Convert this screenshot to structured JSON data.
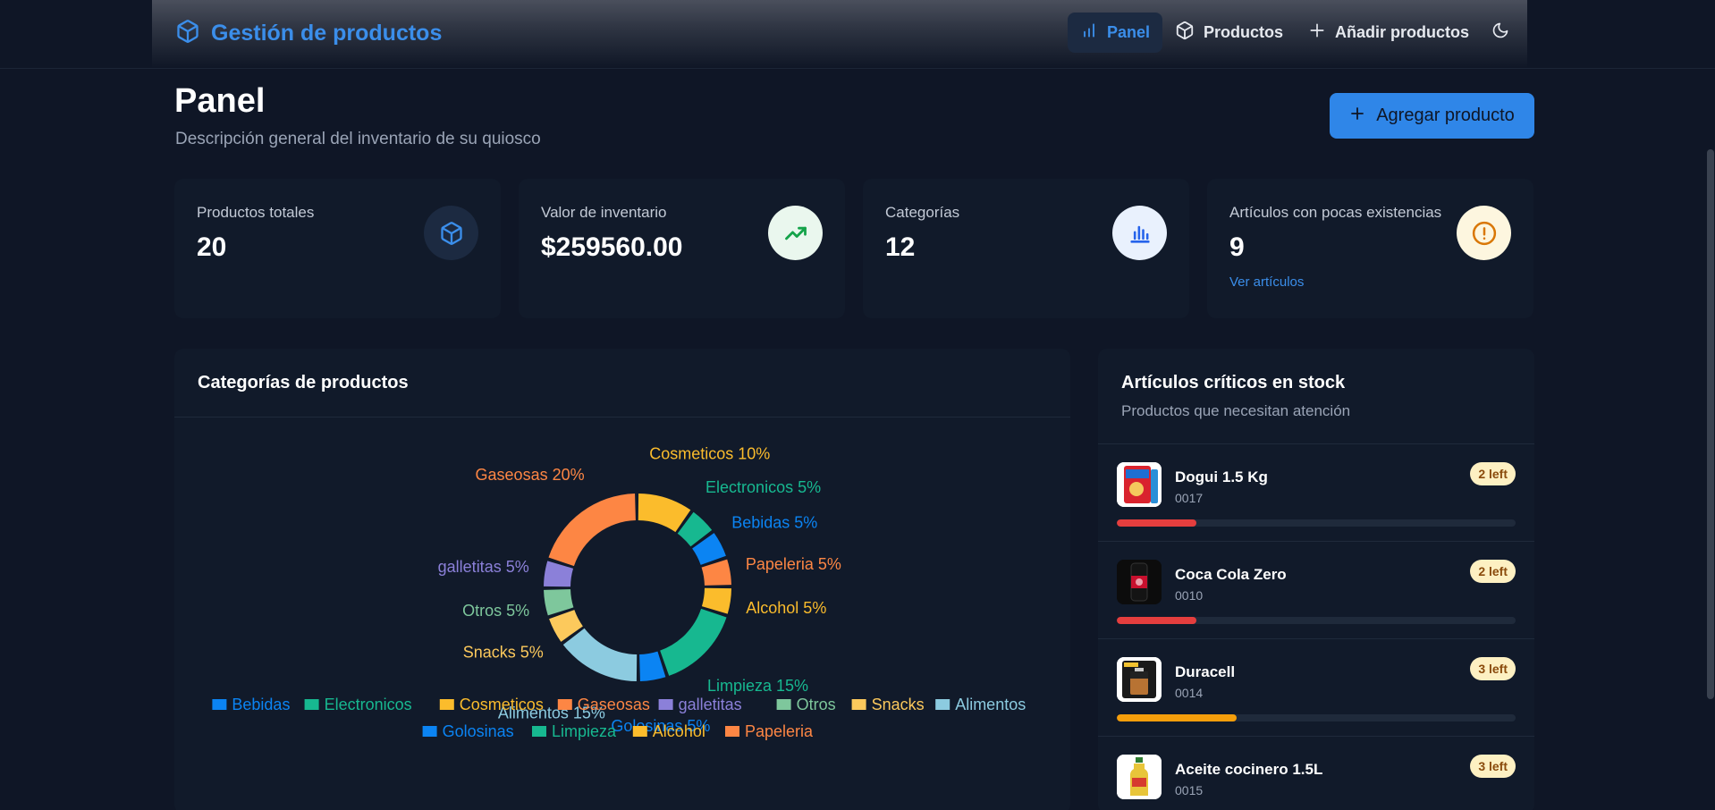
{
  "header": {
    "brand": "Gestión de productos",
    "nav": [
      {
        "label": "Panel",
        "icon": "bar-chart-icon",
        "active": true
      },
      {
        "label": "Productos",
        "icon": "box-icon",
        "active": false
      },
      {
        "label": "Añadir productos",
        "icon": "plus-icon",
        "active": false
      }
    ],
    "theme_icon": "moon-icon"
  },
  "page": {
    "title": "Panel",
    "subtitle": "Descripción general del inventario de su quiosco",
    "add_button": "Agregar producto"
  },
  "stats": [
    {
      "label": "Productos totales",
      "value": "20",
      "icon": "box-icon",
      "icon_bg": "#1c2a41",
      "icon_color": "#3b8eea"
    },
    {
      "label": "Valor de inventario",
      "value": "$259560.00",
      "icon": "trending-up-icon",
      "icon_bg": "#eaf7ee",
      "icon_color": "#15a34a"
    },
    {
      "label": "Categorías",
      "value": "12",
      "icon": "bar-chart-icon",
      "icon_bg": "#e9f1fd",
      "icon_color": "#2563eb"
    },
    {
      "label": "Artículos con pocas existencias",
      "value": "9",
      "link": "Ver artículos",
      "icon": "alert-circle-icon",
      "icon_bg": "#fdf6df",
      "icon_color": "#d97706"
    }
  ],
  "chart_card": {
    "title": "Categorías de productos"
  },
  "chart_data": {
    "type": "pie",
    "style": "donut",
    "categories": [
      "Bebidas",
      "Electronicos",
      "Cosmeticos",
      "Gaseosas",
      "galletitas",
      "Otros",
      "Snacks",
      "Alimentos",
      "Golosinas",
      "Limpieza",
      "Alcohol",
      "Papeleria"
    ],
    "values": [
      5,
      5,
      10,
      20,
      5,
      5,
      5,
      15,
      5,
      15,
      5,
      5
    ],
    "colors": [
      "#0b84f3",
      "#17b890",
      "#fbbc2c",
      "#fd8644",
      "#8b80d9",
      "#7ec79c",
      "#fcc95c",
      "#8ccbe0",
      "#0b84f3",
      "#17b890",
      "#fbbc2c",
      "#fd8644"
    ],
    "slice_labels": [
      "Bebidas 5%",
      "Electronicos 5%",
      "Cosmeticos 10%",
      "Gaseosas 20%",
      "galletitas 5%",
      "Otros 5%",
      "Snacks 5%",
      "Alimentos 15%",
      "Golosinas 5%",
      "Limpieza 15%",
      "Alcohol 5%",
      "Papeleria 5%"
    ],
    "legend": "bottom",
    "legend_rows": [
      [
        "Bebidas",
        "Electronicos",
        "Cosmeticos",
        "Gaseosas",
        "galletitas",
        "Otros",
        "Snacks",
        "Alimentos"
      ],
      [
        "Golosinas",
        "Limpieza",
        "Alcohol",
        "Papeleria"
      ]
    ]
  },
  "critical": {
    "title": "Artículos críticos en stock",
    "subtitle": "Productos que necesitan atención",
    "items": [
      {
        "name": "Dogui 1.5 Kg",
        "code": "0017",
        "badge": "2 left",
        "level": 0.2,
        "color": "#e53e3e",
        "image": "dog-food-bag-image"
      },
      {
        "name": "Coca Cola Zero",
        "code": "0010",
        "badge": "2 left",
        "level": 0.2,
        "color": "#e53e3e",
        "image": "soda-can-image"
      },
      {
        "name": "Duracell",
        "code": "0014",
        "badge": "3 left",
        "level": 0.3,
        "color": "#f59e0b",
        "image": "battery-pack-image"
      },
      {
        "name": "Aceite cocinero 1.5L",
        "code": "0015",
        "badge": "3 left",
        "level": 0.3,
        "color": "#f59e0b",
        "image": "oil-bottle-image"
      }
    ]
  }
}
